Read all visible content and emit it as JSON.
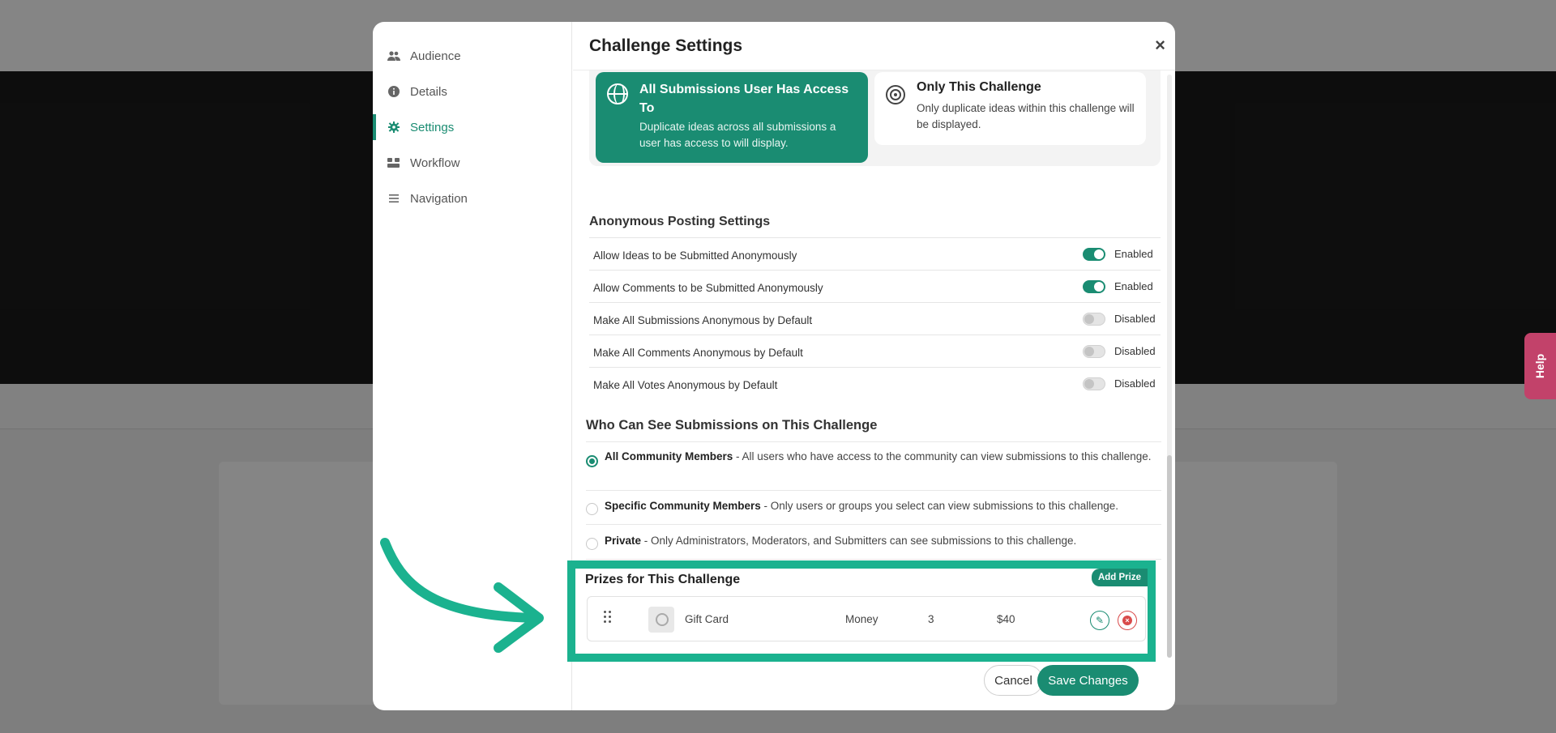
{
  "colors": {
    "accent": "#1a8c72",
    "highlight": "#1bb28f",
    "danger": "#d94b4b",
    "help": "#c2426a"
  },
  "help_tab": {
    "label": "Help"
  },
  "modal": {
    "title": "Challenge Settings",
    "close_label": "×",
    "nav": [
      {
        "label": "Audience",
        "icon": "users-icon"
      },
      {
        "label": "Details",
        "icon": "info-icon"
      },
      {
        "label": "Settings",
        "icon": "gear-icon",
        "active": true
      },
      {
        "label": "Workflow",
        "icon": "workflow-icon"
      },
      {
        "label": "Navigation",
        "icon": "list-icon"
      }
    ],
    "duplicates": {
      "options": [
        {
          "title": "All Submissions User Has Access To",
          "description": "Duplicate ideas across all submissions a user has access to will display.",
          "selected": true,
          "icon": "globe-icon"
        },
        {
          "title": "Only This Challenge",
          "description": "Only duplicate ideas within this challenge will be displayed.",
          "selected": false,
          "icon": "target-icon"
        }
      ]
    },
    "anonymous": {
      "title": "Anonymous Posting Settings",
      "rows": [
        {
          "label": "Allow Ideas to be Submitted Anonymously",
          "enabled": true,
          "state": "Enabled"
        },
        {
          "label": "Allow Comments to be Submitted Anonymously",
          "enabled": true,
          "state": "Enabled"
        },
        {
          "label": "Make All Submissions Anonymous by Default",
          "enabled": false,
          "state": "Disabled"
        },
        {
          "label": "Make All Comments Anonymous by Default",
          "enabled": false,
          "state": "Disabled"
        },
        {
          "label": "Make All Votes Anonymous by Default",
          "enabled": false,
          "state": "Disabled"
        }
      ]
    },
    "visibility": {
      "title": "Who Can See Submissions on This Challenge",
      "options": [
        {
          "label": "All Community Members",
          "description": " - All users who have access to the community can view submissions to this challenge.",
          "checked": true
        },
        {
          "label": "Specific Community Members",
          "description": " - Only users or groups you select can view submissions to this challenge.",
          "checked": false
        },
        {
          "label": "Private",
          "description": " - Only Administrators, Moderators, and Submitters can see submissions to this challenge.",
          "checked": false
        }
      ]
    },
    "prizes": {
      "title": "Prizes for This Challenge",
      "add_label": "Add Prize",
      "items": [
        {
          "name": "Gift Card",
          "type": "Money",
          "quantity": "3",
          "value": "$40"
        }
      ]
    },
    "footer": {
      "cancel_label": "Cancel",
      "save_label": "Save Changes"
    }
  }
}
